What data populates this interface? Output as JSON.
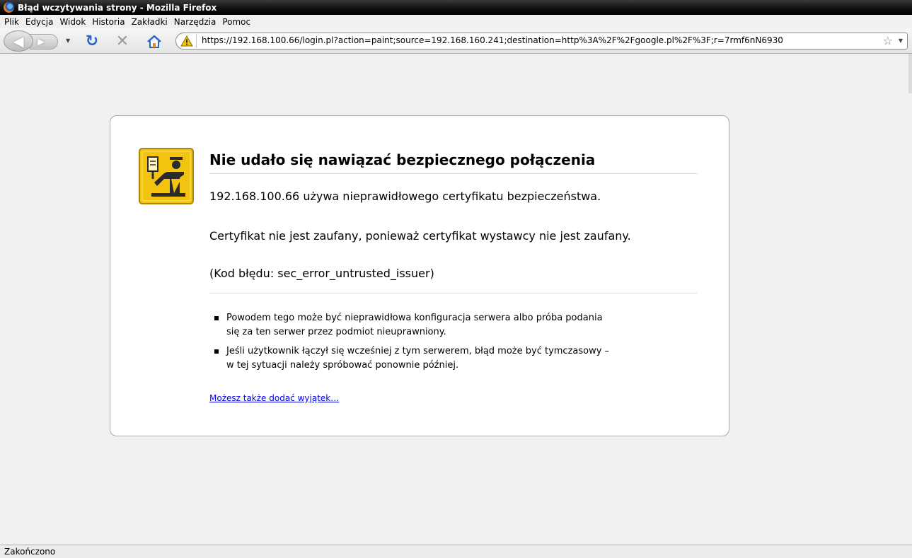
{
  "window": {
    "title": "Błąd wczytywania strony - Mozilla Firefox"
  },
  "menu": {
    "items": [
      "Plik",
      "Edycja",
      "Widok",
      "Historia",
      "Zakładki",
      "Narzędzia",
      "Pomoc"
    ]
  },
  "navbar": {
    "url": "https://192.168.100.66/login.pl?action=paint;source=192.168.160.241;destination=http%3A%2F%2Fgoogle.pl%2F%3F;r=7rmf6nN6930",
    "icons": [
      "back-icon",
      "forward-icon",
      "reload-icon",
      "stop-icon",
      "home-icon",
      "warning-icon",
      "bookmark-star-icon"
    ]
  },
  "error": {
    "title": "Nie udało się nawiązać bezpiecznego połączenia",
    "p1": "192.168.100.66 używa nieprawidłowego certyfikatu bezpieczeństwa.",
    "p2": "Certyfikat nie jest zaufany, ponieważ certyfikat wystawcy nie jest zaufany.",
    "p3": "(Kod błędu: sec_error_untrusted_issuer)",
    "bullets": [
      {
        "line1": "Powodem tego może być nieprawidłowa konfiguracja serwera albo próba podania",
        "line2": "się za ten serwer przez podmiot nieuprawniony."
      },
      {
        "line1": "Jeśli użytkownik łączył się wcześniej z tym serwerem, błąd może być tymczasowy –",
        "line2": "w tej sytuacji należy spróbować ponownie później."
      }
    ],
    "link": "Możesz także dodać wyjątek…"
  },
  "status": {
    "text": "Zakończono"
  },
  "colors": {
    "link": "#0000ee",
    "reload": "#2b63c8",
    "icon_yellow": "#f2c40f"
  }
}
